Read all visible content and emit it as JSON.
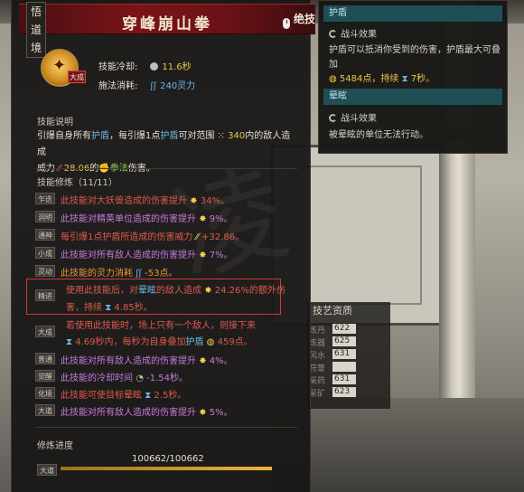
{
  "skill": {
    "realm_chars": [
      "悟",
      "道",
      "境"
    ],
    "name": "穿峰崩山拳",
    "seal_text": "绝技",
    "badge": "大成",
    "cooldown_label": "技能冷却:",
    "cooldown_value": "11.6秒",
    "cost_label": "施法消耗:",
    "cost_value": "240灵力"
  },
  "description": {
    "header": "技能说明",
    "line1_a": "引爆自身所有",
    "line1_b": "护盾",
    "line1_c": "，每引爆1点",
    "line1_d": "护盾",
    "line1_e": "可对范围",
    "line1_f": "340",
    "line1_g": "内的敌人造成",
    "line2_a": "威力",
    "line2_b": "28.06",
    "line2_c": "的",
    "line2_d": "拳法",
    "line2_e": "伤害。"
  },
  "cultivation": {
    "header": "技能修炼（11/11）",
    "mods": [
      {
        "tag": "乍迭",
        "color": "red",
        "text": "此技能对大妖兽造成的伤害提升",
        "value": "34%。"
      },
      {
        "tag": "洞明",
        "color": "purple",
        "text": "此技能对精英单位造成的伤害提升",
        "value": "9%。"
      },
      {
        "tag": "通神",
        "color": "red",
        "text": "每引爆1点护盾所造成的伤害威力",
        "value": "+32.86。"
      },
      {
        "tag": "小成",
        "color": "purple",
        "text": "此技能对所有敌人造成的伤害提升",
        "value": "7%。"
      },
      {
        "tag": "灵动",
        "color": "orange",
        "text": "此技能的灵力消耗",
        "value": "-53点。"
      }
    ],
    "jingjin": {
      "tag": "精进",
      "line1_a": "使用此技能后，对",
      "line1_b": "晕眩",
      "line1_c": "的敌人造成",
      "line1_d": "24.26%的额外伤",
      "line2_a": "害，持续",
      "line2_b": "4.85秒。"
    },
    "dacheng": {
      "tag": "大成",
      "line1": "若使用此技能时，场上只有一个敌人，则接下来",
      "line2_a": "4.69秒内，每秒为自身叠加",
      "line2_b": "护盾",
      "line2_c": "459点。"
    },
    "mods2": [
      {
        "tag": "普通",
        "color": "purple",
        "text": "此技能对所有敌人造成的伤害提升",
        "value": "4%。"
      },
      {
        "tag": "觉醒",
        "color": "purple",
        "text": "此技能的冷却时间",
        "value": "-1.54秒。"
      },
      {
        "tag": "化境",
        "color": "red",
        "text": "此技能可使目标晕眩",
        "value": "2.5秒。"
      },
      {
        "tag": "大道",
        "color": "purple",
        "text": "此技能对所有敌人造成的伤害提升",
        "value": "5%。"
      }
    ]
  },
  "progress": {
    "label": "修炼进度",
    "value_text": "100662/100662",
    "tag": "大道",
    "fraction": 1.0
  },
  "side_tooltip": {
    "shield_title": "护盾",
    "shield_sub": "战斗效果",
    "shield_desc": "护盾可以抵消你受到的伤害，护盾最大可叠加",
    "shield_amount": "5484点，持续",
    "shield_duration": "7秒。",
    "stun_title": "晕眩",
    "stun_sub": "战斗效果",
    "stun_desc": "被晕眩的单位无法行动。"
  },
  "stats_panel": {
    "title": "技艺资质",
    "rows": [
      {
        "name": "炼丹",
        "value": "622"
      },
      {
        "name": "炼器",
        "value": "625"
      },
      {
        "name": "风水",
        "value": "631"
      },
      {
        "name": "符箓",
        "value": ""
      },
      {
        "name": "采药",
        "value": "631"
      },
      {
        "name": "采矿",
        "value": "623"
      }
    ]
  },
  "colors": {
    "header_red": "#7a1418",
    "side_header": "#1f4e57",
    "highlight_border": "#d23a33",
    "gold": "#e9c84a",
    "blue": "#6fb7e9"
  }
}
